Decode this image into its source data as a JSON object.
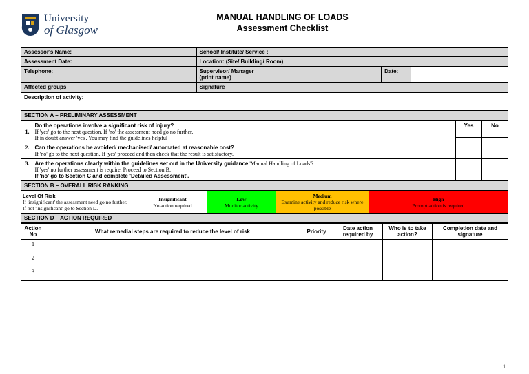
{
  "logo": {
    "top": "University",
    "bottom": "of Glasgow"
  },
  "title": {
    "l1": "MANUAL HANDLING OF LOADS",
    "l2": "Assessment Checklist"
  },
  "meta": {
    "assessor": "Assessor's Name:",
    "school": "School/ Institute/ Service :",
    "date": "Assessment Date:",
    "location": "Location: (Site/ Building/ Room)",
    "tel": "Telephone:",
    "supervisor": "Supervisor/ Manager\n(print name)",
    "dateLbl": "Date:",
    "groups": "Affected groups",
    "sig": "Signature",
    "desc": "Description of activity:"
  },
  "secA": {
    "head": "SECTION A – PRELIMINARY  ASSESSMENT",
    "yes": "Yes",
    "no": "No",
    "q1n": "1.",
    "q1h": "Do the operations involve a significant risk of injury?",
    "q1s1": "If 'yes' go to the next question.  If 'no' the assessment need go no further.",
    "q1s2": "If in doubt answer 'yes'.  You may find the guidelines helpful",
    "q2n": "2.",
    "q2h": "Can the operations be avoided/ mechanised/ automated at reasonable cost?",
    "q2s1": "If 'no' go to the next question.  If 'yes' proceed and then check that the result is satisfactory.",
    "q3n": "3.",
    "q3h": "Are the operations clearly within the guidelines set out in the University guidance",
    "q3hi": " 'Manual Handling of Loads'?",
    "q3s1": "If 'yes' no further assessment is require. Proceed to Section B.",
    "q3s2": "If 'no' go to Section C and complete 'Detailed Assessment'."
  },
  "secB": {
    "head": "SECTION B – OVERALL RISK RANKING",
    "lvlH": "Level Of Risk",
    "lvlS1": "If 'insignificant' the assessment need go no further.",
    "lvlS2": "If not 'insignificant' go to Section D.",
    "insigH": "Insignificant",
    "insigS": "No action required",
    "lowH": "Low",
    "lowS": "Monitor activity",
    "medH": "Medium",
    "medS": "Examine activity and reduce risk where possible",
    "highH": "High",
    "highS": "Prompt action is required"
  },
  "secD": {
    "head": "SECTION D – ACTION  REQUIRED",
    "c1": "Action No",
    "c2": "What remedial steps are required to reduce the level of risk",
    "c3": "Priority",
    "c4": "Date action required by",
    "c5": "Who is to take action?",
    "c6": "Completion date and signature",
    "r1": "1",
    "r2": "2",
    "r3": "3"
  },
  "pageNum": "1"
}
